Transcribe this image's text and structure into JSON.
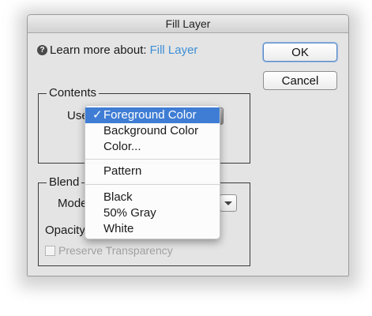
{
  "window": {
    "title": "Fill Layer"
  },
  "help": {
    "prefix": "Learn more about:",
    "link": "Fill Layer",
    "icon": "question-icon"
  },
  "buttons": {
    "ok": "OK",
    "cancel": "Cancel"
  },
  "contents": {
    "title": "Contents",
    "use_label": "Use"
  },
  "blending": {
    "title": "Blend",
    "mode_label": "Mode",
    "opacity_label": "Opacity",
    "preserve_transparency": "Preserve Transparency"
  },
  "menu": {
    "checkmark": "✓",
    "items": [
      "Foreground Color",
      "Background Color",
      "Color...",
      "Pattern",
      "Black",
      "50% Gray",
      "White"
    ],
    "selected": "Foreground Color"
  },
  "colors": {
    "accent": "#3f7dd4",
    "link": "#3d8fd6"
  }
}
